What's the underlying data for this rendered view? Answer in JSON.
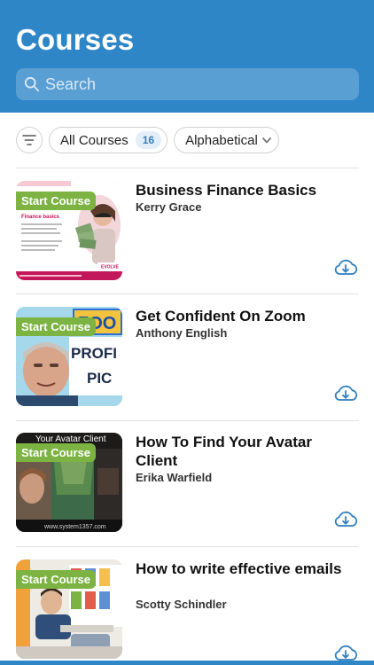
{
  "header": {
    "title": "Courses"
  },
  "search": {
    "placeholder": "Search"
  },
  "filters": {
    "all_label": "All Courses",
    "count": "16",
    "sort_label": "Alphabetical"
  },
  "courses": [
    {
      "title": "Business Finance Basics",
      "author": "Kerry Grace",
      "badge": "Start Course",
      "thumb_text": "Finance basics"
    },
    {
      "title": "Get Confident On Zoom",
      "author": "Anthony English",
      "badge": "Start Course",
      "thumb_text": "ZOOM PROFI PIC"
    },
    {
      "title": "How To Find Your Avatar Client",
      "author": "Erika Warfield",
      "badge": "Start Course",
      "thumb_text": "Your Avatar Client"
    },
    {
      "title": "How to write effective emails",
      "author": "Scotty Schindler",
      "badge": "Start Course",
      "thumb_text": ""
    }
  ],
  "colors": {
    "header": "#2f86c7",
    "badge_green": "#7cb342",
    "accent_blue": "#2f7fbf"
  }
}
